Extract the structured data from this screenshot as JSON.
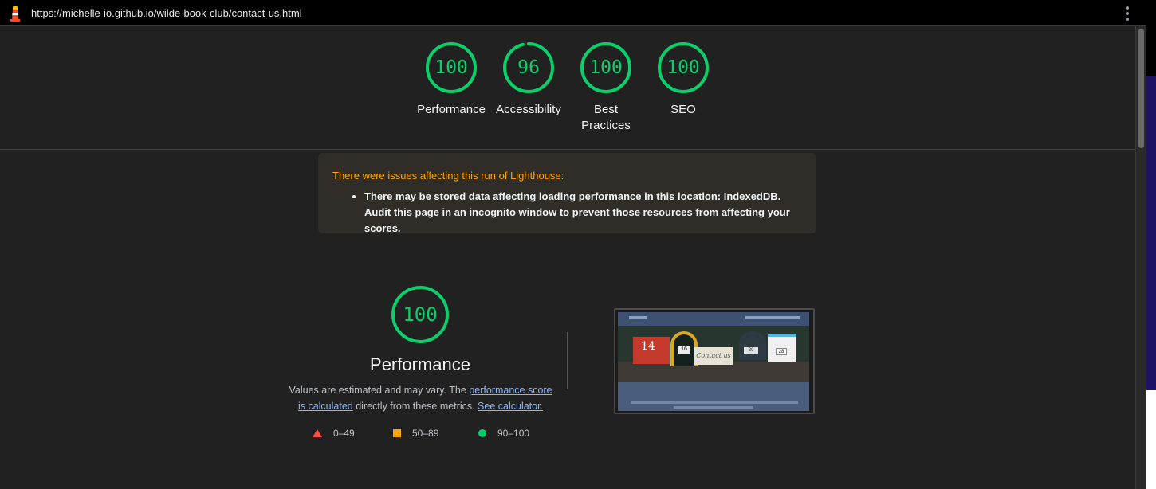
{
  "browser": {
    "url": "https://michelle-io.github.io/wilde-book-club/contact-us.html",
    "menu_icon": "kebab-menu-icon",
    "logo_icon": "lighthouse-icon"
  },
  "gauges": [
    {
      "score": "100",
      "label": "Performance",
      "value": 100
    },
    {
      "score": "96",
      "label": "Accessibility",
      "value": 96
    },
    {
      "score": "100",
      "label": "Best Practices",
      "value": 100
    },
    {
      "score": "100",
      "label": "SEO",
      "value": 100
    }
  ],
  "warning": {
    "title": "There were issues affecting this run of Lighthouse:",
    "item": "There may be stored data affecting loading performance in this location: IndexedDB. Audit this page in an incognito window to prevent those resources from affecting your scores."
  },
  "performance": {
    "score": "100",
    "title": "Performance",
    "desc_prefix": "Values are estimated and may vary. The ",
    "link1": "performance score is calculated",
    "desc_middle": " directly from these metrics. ",
    "link2": "See calculator."
  },
  "legend": [
    {
      "range": "0–49",
      "color": "#ff4e42"
    },
    {
      "range": "50–89",
      "color": "#ffa400"
    },
    {
      "range": "90–100",
      "color": "#0cce6b"
    }
  ],
  "thumbnail": {
    "box_red": "14",
    "box_arch": "16",
    "sign": "Contact us",
    "box_dark": "20",
    "box_white": "28"
  },
  "colors": {
    "pass": "#0cce6b",
    "average": "#ffa400",
    "fail": "#ff4e42",
    "background": "#212121"
  }
}
